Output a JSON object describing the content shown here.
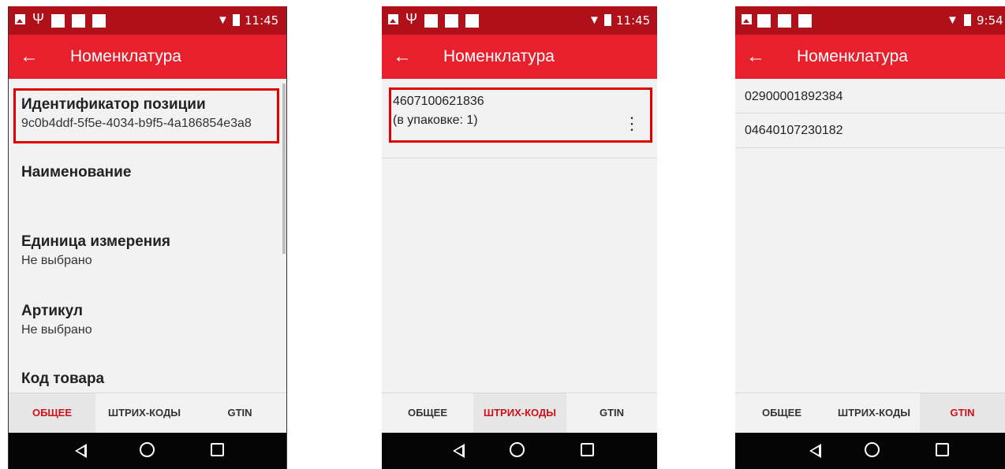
{
  "status": {
    "time_a": "11:45",
    "time_b": "9:54"
  },
  "appbar": {
    "title": "Номенклатура",
    "back_icon": "arrow-left-icon"
  },
  "tabs": {
    "general": "ОБЩЕЕ",
    "barcodes": "ШТРИХ-КОДЫ",
    "gtin": "GTIN"
  },
  "screen_general": {
    "fields": [
      {
        "label": "Идентификатор позиции",
        "value": "9c0b4ddf-5f5e-4034-b9f5-4a186854e3a8"
      },
      {
        "label": "Наименование",
        "value": ""
      },
      {
        "label": "Единица измерения",
        "value": "Не выбрано"
      },
      {
        "label": "Артикул",
        "value": "Не выбрано"
      },
      {
        "label": "Код товара",
        "value": ""
      }
    ]
  },
  "screen_barcodes": {
    "items": [
      {
        "code": "4607100621836",
        "note": "(в упаковке: 1)"
      }
    ]
  },
  "screen_gtin": {
    "items": [
      "02900001892384",
      "04640107230182"
    ]
  },
  "colors": {
    "appbar": "#e8202d",
    "statusbar": "#b0101a",
    "active_tab": "#d0101b",
    "highlight": "#e00000"
  }
}
